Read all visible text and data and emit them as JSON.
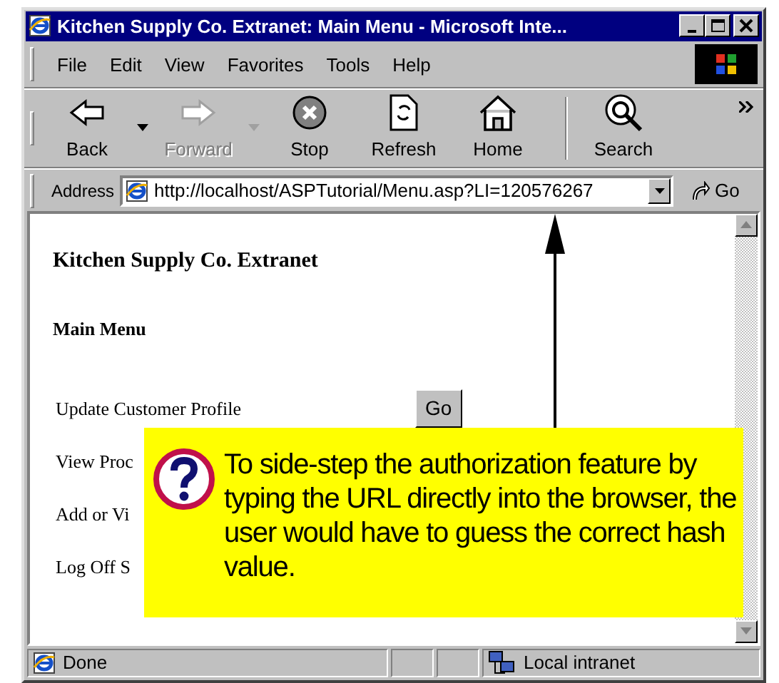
{
  "window": {
    "title": "Kitchen Supply Co. Extranet: Main Menu - Microsoft Inte..."
  },
  "menu_bar": [
    "File",
    "Edit",
    "View",
    "Favorites",
    "Tools",
    "Help"
  ],
  "toolbar": [
    {
      "kind": "back",
      "label": "Back",
      "disabled": false,
      "dropdown": true
    },
    {
      "kind": "forward",
      "label": "Forward",
      "disabled": true,
      "dropdown": true
    },
    {
      "kind": "stop",
      "label": "Stop",
      "disabled": false,
      "dropdown": false
    },
    {
      "kind": "refresh",
      "label": "Refresh",
      "disabled": false,
      "dropdown": false
    },
    {
      "kind": "home",
      "label": "Home",
      "disabled": false,
      "dropdown": false
    },
    {
      "kind": "search",
      "label": "Search",
      "disabled": false,
      "dropdown": false
    }
  ],
  "address_bar": {
    "label": "Address",
    "value": "http://localhost/ASPTutorial/Menu.asp?LI=120576267",
    "go": "Go"
  },
  "page": {
    "heading": "Kitchen Supply Co. Extranet",
    "subheading": "Main Menu",
    "menu_items": [
      {
        "label": "Update Customer Profile",
        "button": "Go"
      },
      {
        "label": "View Proc"
      },
      {
        "label": "Add or Vi"
      },
      {
        "label": "Log Off S"
      }
    ]
  },
  "callout": {
    "text": "To side-step the authorization feature by typing the URL directly into the browser, the user would have to guess the correct hash value."
  },
  "status_bar": {
    "text": "Done",
    "zone": "Local intranet"
  }
}
